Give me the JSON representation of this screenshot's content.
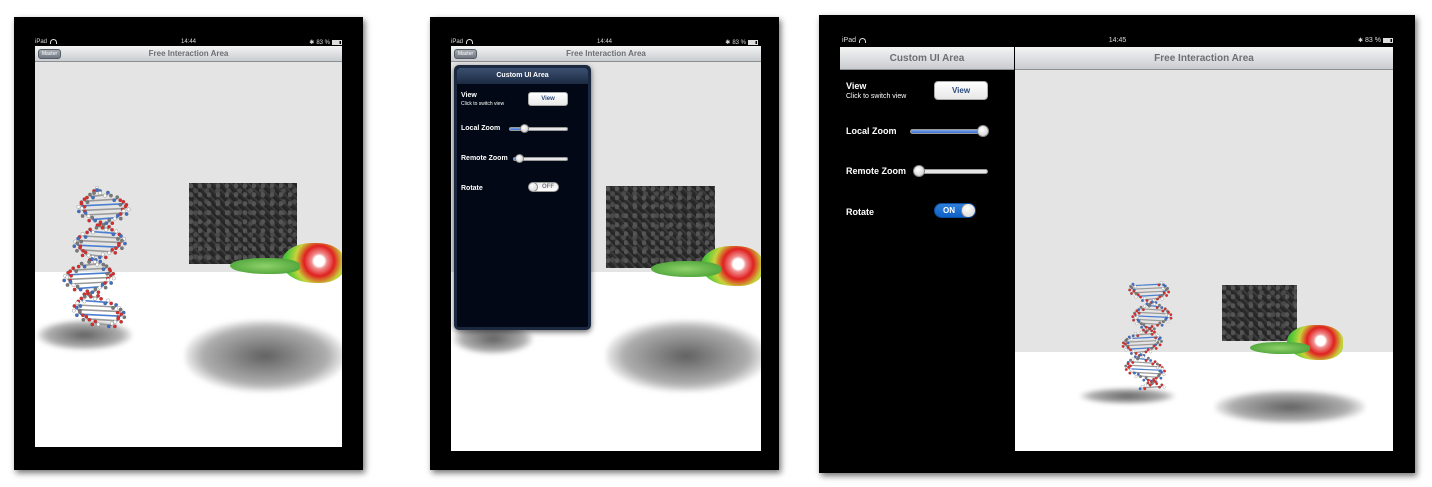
{
  "status": {
    "carrier": "iPad",
    "time_a": "14:44",
    "time_b": "14:44",
    "time_c": "14:45",
    "battery": "83 %"
  },
  "nav": {
    "title": "Free Interaction Area",
    "master_label": "Master"
  },
  "panel": {
    "title": "Custom UI Area",
    "view_label": "View",
    "view_sub": "Click to switch view",
    "view_button": "View",
    "local_zoom_label": "Local Zoom",
    "remote_zoom_label": "Remote Zoom",
    "rotate_label": "Rotate",
    "toggle_off": "OFF",
    "toggle_on": "ON"
  },
  "controls": {
    "popover_local_zoom": 0.25,
    "popover_remote_zoom": 0.1,
    "sidebar_local_zoom": 1.0,
    "sidebar_remote_zoom": 0.0,
    "popover_rotate": false,
    "sidebar_rotate": true
  },
  "colors": {
    "accent": "#3c6fd4",
    "toggle_on": "#1a6fd6",
    "nav_text": "#6c6f74"
  },
  "icons": [
    "wifi-icon",
    "bluetooth-icon",
    "battery-icon"
  ]
}
